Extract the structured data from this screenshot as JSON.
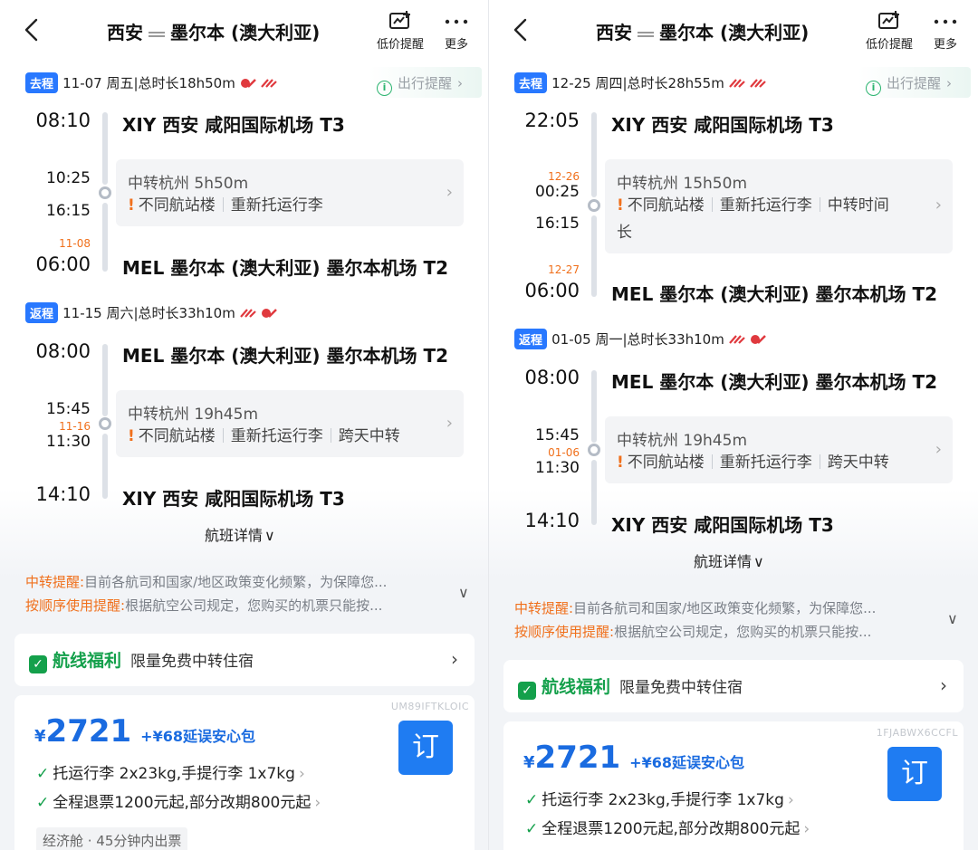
{
  "panels": [
    {
      "header": {
        "from": "西安",
        "to": "墨尔本 (澳大利亚)",
        "price_alert_label": "低价提醒",
        "more_label": "更多"
      },
      "outbound": {
        "tag": "去程",
        "date": "11-07 周五",
        "duration": "总时长18h50m",
        "remind": "出行提醒",
        "dep_time": "08:10",
        "dep_airport": "XIY  西安 咸阳国际机场 T3",
        "transfer": {
          "arr_time": "10:25",
          "arr_day": "",
          "dep_time": "16:15",
          "dep_day": "",
          "title": "中转杭州 5h50m",
          "warnings": [
            "不同航站楼",
            "重新托运行李"
          ],
          "extra": ""
        },
        "arr_day": "11-08",
        "arr_time": "06:00",
        "arr_airport": "MEL  墨尔本 (澳大利亚) 墨尔本机场 T2"
      },
      "return": {
        "tag": "返程",
        "date": "11-15 周六",
        "duration": "总时长33h10m",
        "dep_time": "08:00",
        "dep_airport": "MEL  墨尔本 (澳大利亚) 墨尔本机场 T2",
        "transfer": {
          "arr_time": "15:45",
          "arr_day": "",
          "dep_time": "11:30",
          "dep_day": "11-16",
          "title": "中转杭州 19h45m",
          "warnings": [
            "不同航站楼",
            "重新托运行李",
            "跨天中转"
          ]
        },
        "arr_time": "14:10",
        "arr_airport": "XIY  西安 咸阳国际机场 T3"
      },
      "details_label": "航班详情",
      "notice": {
        "k1": "中转提醒:",
        "t1": "目前各航司和国家/地区政策变化频繁，为保障您...",
        "k2": "按顺序使用提醒:",
        "t2": "根据航空公司规定，您购买的机票只能按..."
      },
      "benefit": {
        "title": "航线福利",
        "sub": "限量免费中转住宿"
      },
      "offer": {
        "code": "UM89IFTKLOIC",
        "yen": "¥",
        "price": "2721",
        "addon": "+¥68延误安心包",
        "book": "订",
        "baggage": "托运行李 2x23kg,手提行李 1x7kg",
        "refund": "全程退票1200元起,部分改期800元起",
        "cabin": "经济舱 · 45分钟内出票"
      }
    },
    {
      "header": {
        "from": "西安",
        "to": "墨尔本 (澳大利亚)",
        "price_alert_label": "低价提醒",
        "more_label": "更多"
      },
      "outbound": {
        "tag": "去程",
        "date": "12-25 周四",
        "duration": "总时长28h55m",
        "remind": "出行提醒",
        "dep_time": "22:05",
        "dep_airport": "XIY  西安 咸阳国际机场 T3",
        "transfer": {
          "arr_time": "00:25",
          "arr_day": "12-26",
          "dep_time": "16:15",
          "dep_day": "",
          "title": "中转杭州 15h50m",
          "warnings": [
            "不同航站楼",
            "重新托运行李",
            "中转时间"
          ],
          "extra": "长"
        },
        "arr_day": "12-27",
        "arr_time": "06:00",
        "arr_airport": "MEL  墨尔本 (澳大利亚) 墨尔本机场 T2"
      },
      "return": {
        "tag": "返程",
        "date": "01-05 周一",
        "duration": "总时长33h10m",
        "dep_time": "08:00",
        "dep_airport": "MEL  墨尔本 (澳大利亚) 墨尔本机场 T2",
        "transfer": {
          "arr_time": "15:45",
          "arr_day": "",
          "dep_time": "11:30",
          "dep_day": "01-06",
          "title": "中转杭州 19h45m",
          "warnings": [
            "不同航站楼",
            "重新托运行李",
            "跨天中转"
          ]
        },
        "arr_time": "14:10",
        "arr_airport": "XIY  西安 咸阳国际机场 T3"
      },
      "details_label": "航班详情",
      "notice": {
        "k1": "中转提醒:",
        "t1": "目前各航司和国家/地区政策变化频繁，为保障您...",
        "k2": "按顺序使用提醒:",
        "t2": "根据航空公司规定，您购买的机票只能按..."
      },
      "benefit": {
        "title": "航线福利",
        "sub": "限量免费中转住宿"
      },
      "offer": {
        "code": "1FJABWX6CCFL",
        "yen": "¥",
        "price": "2721",
        "addon": "+¥68延误安心包",
        "book": "订",
        "baggage": "托运行李 2x23kg,手提行李 1x7kg",
        "refund": "全程退票1200元起,部分改期800元起"
      }
    }
  ],
  "colors": {
    "accent": "#2878ff",
    "price": "#1a6be0",
    "warning": "#f0701c",
    "benefit": "#14a04b"
  }
}
